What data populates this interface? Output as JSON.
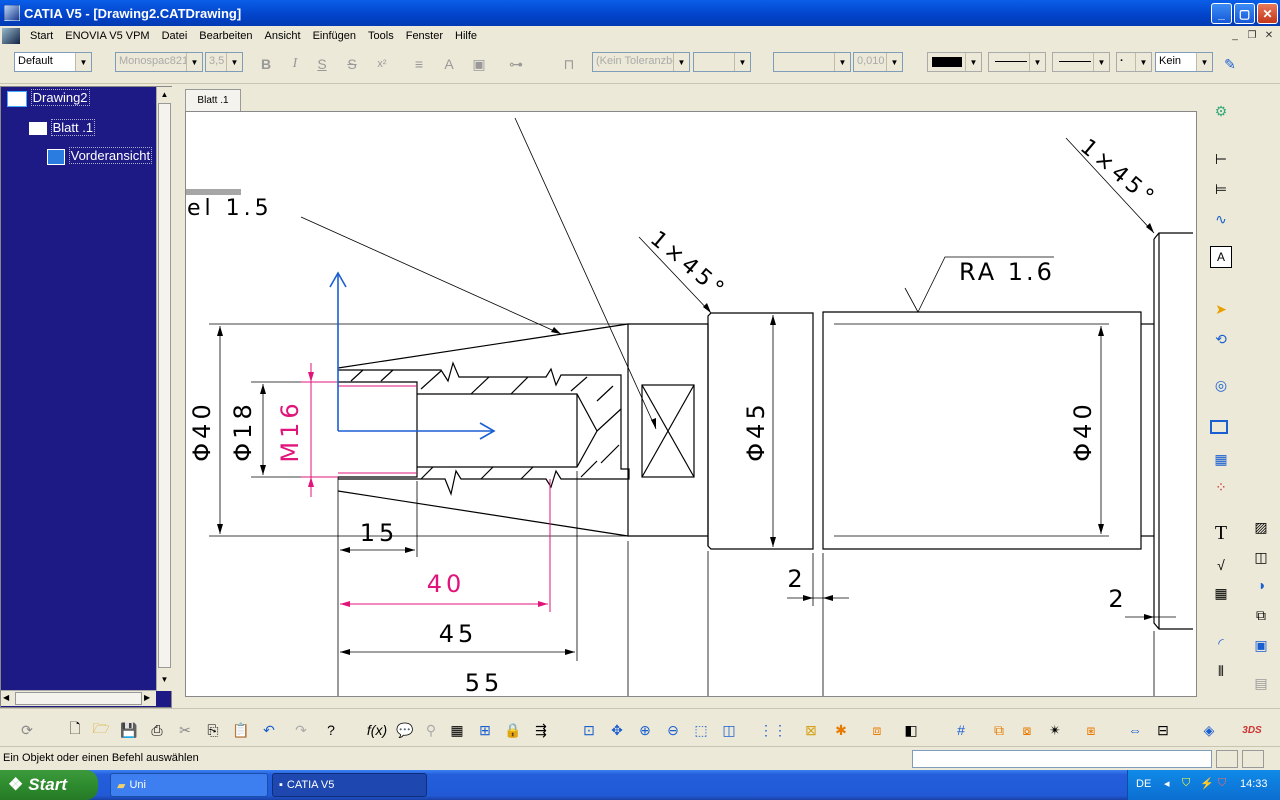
{
  "title": "CATIA V5 - [Drawing2.CATDrawing]",
  "menu": [
    "Start",
    "ENOVIA V5 VPM",
    "Datei",
    "Bearbeiten",
    "Ansicht",
    "Einfügen",
    "Tools",
    "Fenster",
    "Hilfe"
  ],
  "toolbar": {
    "style_combo": "Default",
    "font_combo": "Monospac821",
    "size_combo": "3,5",
    "tolerance_combo": "(Kein Toleranzbe",
    "value_combo": "0,010",
    "line_end_combo": "Kein",
    "bold": "B",
    "italic": "I",
    "underline": "S",
    "strike": "S",
    "superscript": "x²"
  },
  "tree": {
    "root": "Drawing2",
    "sheet": "Blatt .1",
    "view": "Vorderansicht"
  },
  "tab": "Blatt .1",
  "drawing": {
    "dims": {
      "d40_left": "Φ40",
      "d18": "Φ18",
      "m16": "M16",
      "d45": "Φ45",
      "d40_right": "Φ40",
      "l15": "15",
      "l40": "40",
      "l45": "45",
      "l55": "55",
      "gap2a": "2",
      "gap2b": "2"
    },
    "chamfer1": "1×45°",
    "chamfer2": "1×45°",
    "roughness": "RA 1.6",
    "partial_label": "el 1.5"
  },
  "status": "Ein Objekt oder einen Befehl auswählen",
  "taskbar": {
    "start": "Start",
    "tasks": [
      "Uni",
      "CATIA V5"
    ],
    "lang": "DE",
    "clock": "14:33"
  },
  "colors": {
    "tree_bg": "#1e1a85",
    "axis": "#1a5fd0",
    "thread": "#e0147a",
    "titlebar": "#0243c9"
  }
}
